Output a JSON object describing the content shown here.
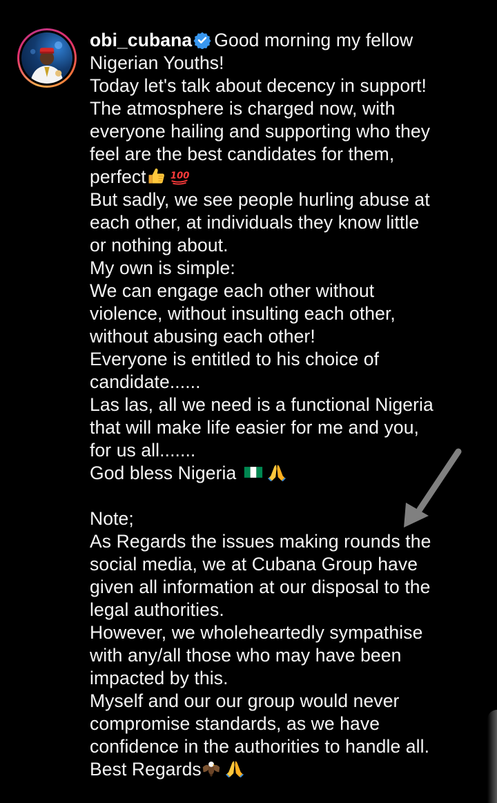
{
  "post": {
    "username": "obi_cubana",
    "verified": true,
    "first_line": "Good morning my fellow",
    "lines": [
      "Nigerian Youths!",
      "Today let's talk about decency in support!",
      "The atmosphere is charged now, with",
      "everyone hailing and supporting who they",
      "feel are the best candidates for them,",
      "perfect",
      "But sadly, we see people hurling abuse at",
      "each other, at individuals they know little",
      "or nothing about.",
      "My own is simple:",
      "We can engage each other without",
      "violence, without insulting each other,",
      "without abusing each other!",
      "Everyone is entitled to his choice of",
      "candidate......",
      "Las las, all we need is a functional Nigeria",
      "that will make life easier for me and you,",
      "for us all.......",
      "God bless Nigeria",
      "",
      "Note;",
      "As Regards the issues making rounds the",
      "social media, we at Cubana Group have",
      "given all information at our disposal to the",
      "legal authorities.",
      "However, we wholeheartedly sympathise",
      "with any/all those who may have been",
      "impacted by this.",
      "Myself and our our group would never",
      "compromise standards, as we have",
      "confidence in the authorities to handle all.",
      "Best Regards"
    ]
  },
  "colors": {
    "background": "#000000",
    "text": "#f5f5f5",
    "verified_badge": "#3897f0",
    "arrow": "#808080"
  },
  "icons": {
    "verified": "verified-badge-icon",
    "thumbs_up": "thumbs-up-emoji",
    "hundred": "hundred-points-emoji",
    "flag": "nigeria-flag-emoji",
    "pray": "folded-hands-emoji",
    "eagle": "eagle-emoji",
    "arrow": "pointer-arrow"
  }
}
